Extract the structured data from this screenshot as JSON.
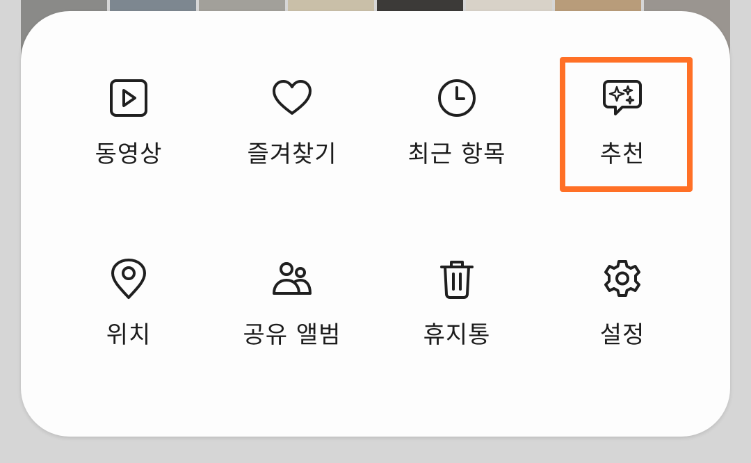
{
  "background_thumbnails": [
    {
      "color": "#8a8a88"
    },
    {
      "color": "#7d8790"
    },
    {
      "color": "#a2a09a"
    },
    {
      "color": "#c9bfa8"
    },
    {
      "color": "#3c3a38"
    },
    {
      "color": "#d8d2c8"
    },
    {
      "color": "#b89c7a"
    },
    {
      "color": "#9a9590"
    }
  ],
  "menu": {
    "items": [
      {
        "label": "동영상",
        "icon": "video-icon"
      },
      {
        "label": "즐겨찾기",
        "icon": "heart-icon"
      },
      {
        "label": "최근 항목",
        "icon": "clock-icon"
      },
      {
        "label": "추천",
        "icon": "suggestions-icon"
      },
      {
        "label": "위치",
        "icon": "location-pin-icon"
      },
      {
        "label": "공유 앨범",
        "icon": "shared-album-icon"
      },
      {
        "label": "휴지통",
        "icon": "trash-icon"
      },
      {
        "label": "설정",
        "icon": "gear-icon"
      }
    ],
    "highlighted_item": "추천"
  },
  "colors": {
    "highlight": "#ff7026",
    "icon_stroke": "#1f1f1f",
    "sheet_background": "#fdfdfd"
  }
}
